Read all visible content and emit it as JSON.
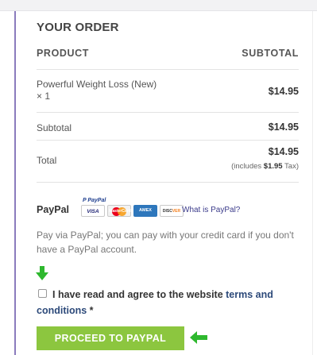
{
  "order": {
    "heading": "YOUR ORDER",
    "columns": {
      "product": "PRODUCT",
      "subtotal": "SUBTOTAL"
    },
    "item": {
      "name": "Powerful Weight Loss (New)",
      "qty": "× 1",
      "price": "$14.95"
    },
    "subtotal": {
      "label": "Subtotal",
      "value": "$14.95"
    },
    "total": {
      "label": "Total",
      "value": "$14.95",
      "tax_prefix": "(includes ",
      "tax_amount": "$1.95",
      "tax_suffix": " Tax)"
    }
  },
  "payment": {
    "label": "PayPal",
    "logo_text": "P PayPal",
    "cards": {
      "visa": "VISA",
      "mastercard": "MasterCard",
      "amex": "AMEX",
      "discover_a": "DISC",
      "discover_b": "VER"
    },
    "what_link": "What is PayPal?",
    "description": "Pay via PayPal; you can pay with your credit card if you don't have a PayPal account."
  },
  "terms": {
    "text": "I have read and agree to the website ",
    "link": "terms and conditions",
    "required": " *"
  },
  "button": {
    "label": "PROCEED TO PAYPAL"
  },
  "colors": {
    "accent_green": "#8cc63f",
    "arrow_green": "#2eb82e",
    "sidebar_line": "#8a7bbd"
  }
}
